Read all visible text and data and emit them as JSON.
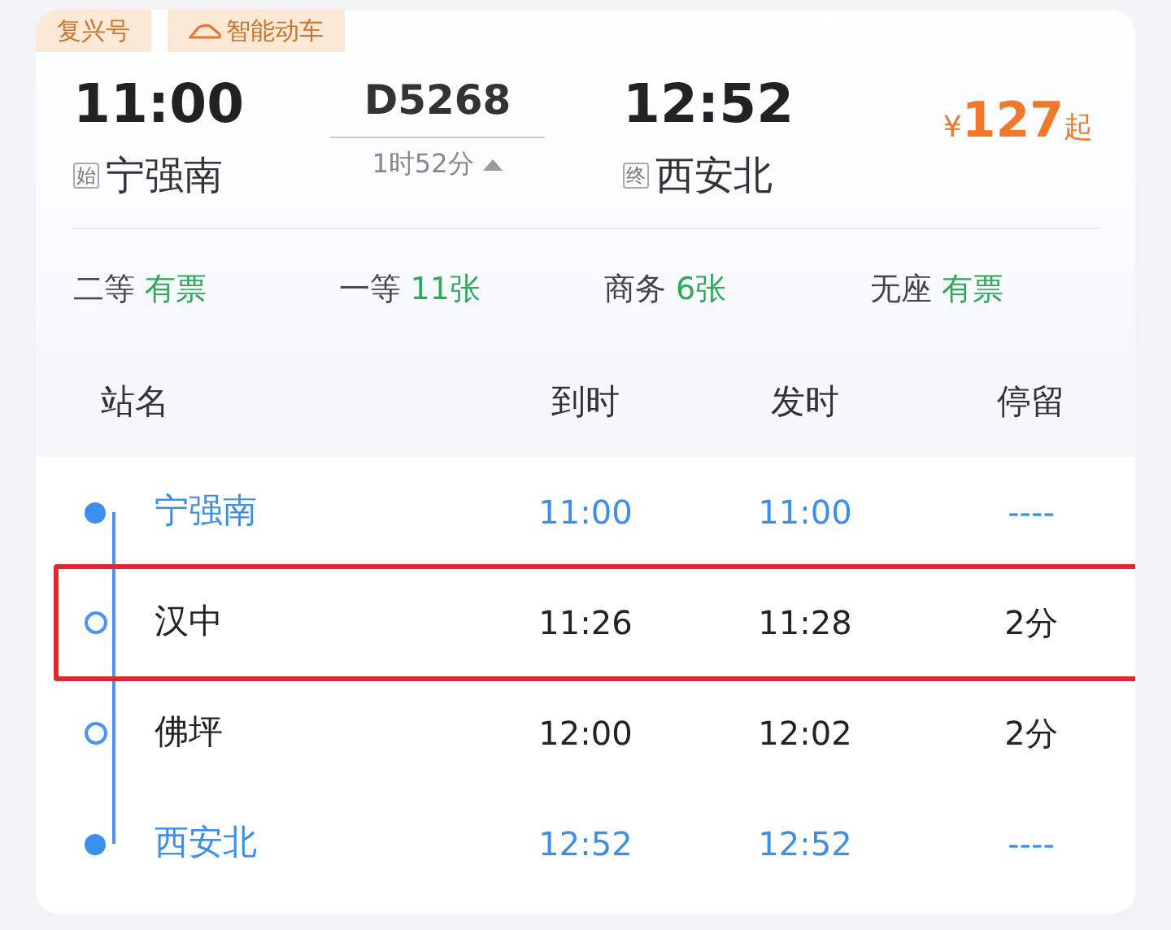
{
  "tags": [
    {
      "label": "复兴号",
      "kind": "plain"
    },
    {
      "label": "智能动车",
      "kind": "train"
    }
  ],
  "departure": {
    "time": "11:00",
    "marker": "始",
    "station": "宁强南"
  },
  "train": {
    "number": "D5268",
    "duration": "1时52分",
    "expanded": true
  },
  "arrival": {
    "time": "12:52",
    "marker": "终",
    "station": "西安北"
  },
  "price": {
    "currency": "¥",
    "amount": "127",
    "suffix": "起"
  },
  "seats": [
    {
      "class": "二等",
      "availability": "有票"
    },
    {
      "class": "一等",
      "availability": "11张"
    },
    {
      "class": "商务",
      "availability": "6张"
    },
    {
      "class": "无座",
      "availability": "有票"
    }
  ],
  "timetable": {
    "columns": [
      "站名",
      "到时",
      "发时",
      "停留"
    ],
    "rows": [
      {
        "station": "宁强南",
        "arrive": "11:00",
        "depart": "11:00",
        "stop": "----",
        "kind": "terminal",
        "highlighted": false
      },
      {
        "station": "汉中",
        "arrive": "11:26",
        "depart": "11:28",
        "stop": "2分",
        "kind": "stop",
        "highlighted": true
      },
      {
        "station": "佛坪",
        "arrive": "12:00",
        "depart": "12:02",
        "stop": "2分",
        "kind": "stop",
        "highlighted": false
      },
      {
        "station": "西安北",
        "arrive": "12:52",
        "depart": "12:52",
        "stop": "----",
        "kind": "terminal",
        "highlighted": false
      }
    ]
  }
}
